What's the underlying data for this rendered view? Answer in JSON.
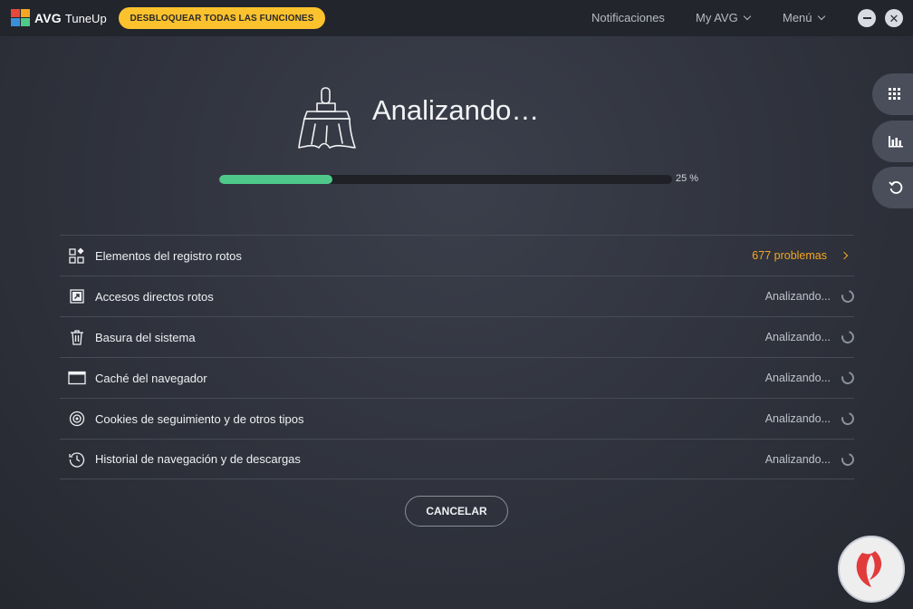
{
  "app": {
    "brand": "AVG",
    "product": "TuneUp",
    "unlock_label": "DESBLOQUEAR TODAS LAS FUNCIONES"
  },
  "nav": {
    "notifications": "Notificaciones",
    "my_avg": "My AVG",
    "menu": "Menú"
  },
  "window": {
    "minimize_icon": "minimize-icon",
    "close_icon": "close-icon",
    "close_glyph": "✕"
  },
  "side_tools": [
    "grid-icon",
    "bar-chart-icon",
    "undo-icon"
  ],
  "scan": {
    "title": "Analizando…",
    "progress_percent": 25,
    "progress_label": "25 %"
  },
  "items": [
    {
      "icon": "registry-icon",
      "label": "Elementos del registro rotos",
      "status": "677 problemas",
      "state": "issues"
    },
    {
      "icon": "shortcut-icon",
      "label": "Accesos directos rotos",
      "status": "Analizando...",
      "state": "scanning"
    },
    {
      "icon": "trash-icon",
      "label": "Basura del sistema",
      "status": "Analizando...",
      "state": "scanning"
    },
    {
      "icon": "browser-window-icon",
      "label": "Caché del navegador",
      "status": "Analizando...",
      "state": "scanning"
    },
    {
      "icon": "target-icon",
      "label": "Cookies de seguimiento y de otros tipos",
      "status": "Analizando...",
      "state": "scanning"
    },
    {
      "icon": "history-clock-icon",
      "label": "Historial de navegación y de descargas",
      "status": "Analizando...",
      "state": "scanning"
    }
  ],
  "actions": {
    "cancel": "CANCELAR"
  },
  "colors": {
    "accent_yellow": "#fcc22e",
    "progress_green": "#4fc98a",
    "warning_orange": "#f5a623",
    "background": "#2f323c"
  }
}
